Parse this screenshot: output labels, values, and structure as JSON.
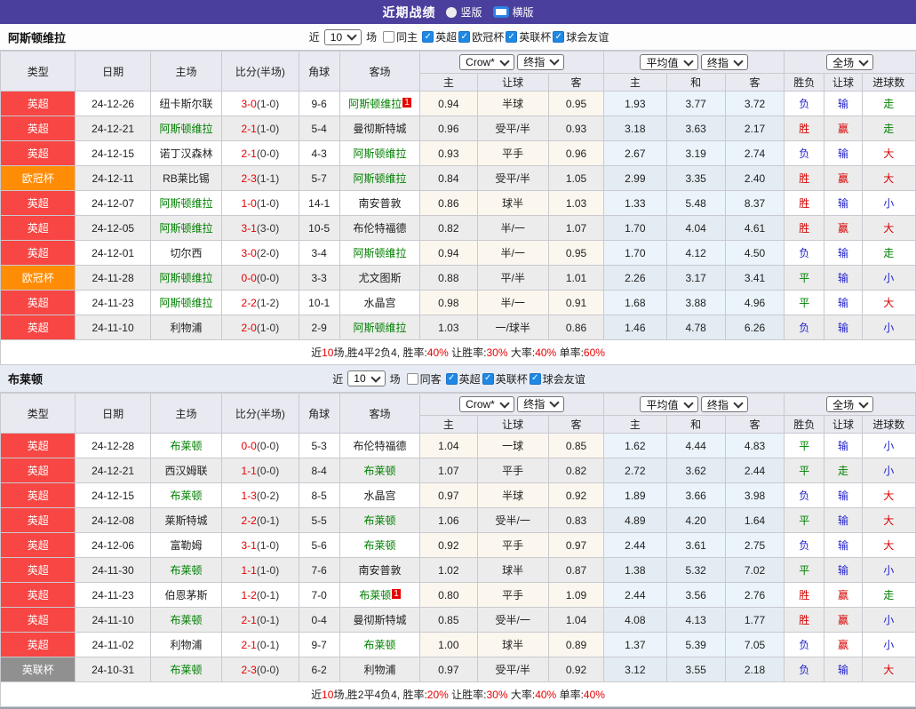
{
  "title_bar": {
    "title": "近期战绩",
    "radios": [
      {
        "label": "竖版",
        "selected": false
      },
      {
        "label": "横版",
        "selected": true
      }
    ]
  },
  "colors": {
    "topbar_purple": "#4b3f9d",
    "league_red": "#f74643",
    "league_orange": "#ff8c05",
    "league_gray": "#909090",
    "focus_team_green": "#008000",
    "score_red": "#e60000",
    "result_red": "#d60000",
    "result_blue": "#2222cc",
    "result_green": "#008000",
    "checkbox_blue": "#1e88e5",
    "avg_col_blue": "#eaf4fa",
    "crow_col_cream": "#fcf7ee"
  },
  "table_header": {
    "cols": [
      "类型",
      "日期",
      "主场",
      "比分(半场)",
      "角球",
      "客场"
    ],
    "sub": [
      "主",
      "让球",
      "客",
      "主",
      "和",
      "客",
      "胜负",
      "让球",
      "进球数"
    ],
    "selects": {
      "crow": "Crow*",
      "final1": "终指",
      "avg": "平均值",
      "final2": "终指",
      "full": "全场"
    }
  },
  "sections": [
    {
      "team": "阿斯顿维拉",
      "filter": {
        "near_label": "近",
        "count": "10",
        "games_label": "场",
        "same_label": "同主",
        "same_checked": false,
        "leagues": [
          {
            "label": "英超",
            "checked": true
          },
          {
            "label": "欧冠杯",
            "checked": true
          },
          {
            "label": "英联杯",
            "checked": true
          },
          {
            "label": "球会友谊",
            "checked": true
          }
        ]
      },
      "rows": [
        {
          "league": "英超",
          "date": "24-12-26",
          "home": "纽卡斯尔联",
          "ft": "3-0",
          "ht": "(1-0)",
          "corner": "9-6",
          "away": "阿斯顿维拉",
          "badge": "1",
          "crow": [
            "0.94",
            "半球",
            "0.95"
          ],
          "avg": [
            "1.93",
            "3.77",
            "3.72"
          ],
          "results": [
            "负",
            "输",
            "走"
          ]
        },
        {
          "league": "英超",
          "date": "24-12-21",
          "home": "阿斯顿维拉",
          "ft": "2-1",
          "ht": "(1-0)",
          "corner": "5-4",
          "away": "曼彻斯特城",
          "crow": [
            "0.96",
            "受平/半",
            "0.93"
          ],
          "avg": [
            "3.18",
            "3.63",
            "2.17"
          ],
          "results": [
            "胜",
            "赢",
            "走"
          ]
        },
        {
          "league": "英超",
          "date": "24-12-15",
          "home": "诺丁汉森林",
          "ft": "2-1",
          "ht": "(0-0)",
          "corner": "4-3",
          "away": "阿斯顿维拉",
          "crow": [
            "0.93",
            "平手",
            "0.96"
          ],
          "avg": [
            "2.67",
            "3.19",
            "2.74"
          ],
          "results": [
            "负",
            "输",
            "大"
          ]
        },
        {
          "league": "欧冠杯",
          "date": "24-12-11",
          "home": "RB莱比锡",
          "ft": "2-3",
          "ht": "(1-1)",
          "corner": "5-7",
          "away": "阿斯顿维拉",
          "crow": [
            "0.84",
            "受平/半",
            "1.05"
          ],
          "avg": [
            "2.99",
            "3.35",
            "2.40"
          ],
          "results": [
            "胜",
            "赢",
            "大"
          ]
        },
        {
          "league": "英超",
          "date": "24-12-07",
          "home": "阿斯顿维拉",
          "ft": "1-0",
          "ht": "(1-0)",
          "corner": "14-1",
          "away": "南安普敦",
          "crow": [
            "0.86",
            "球半",
            "1.03"
          ],
          "avg": [
            "1.33",
            "5.48",
            "8.37"
          ],
          "results": [
            "胜",
            "输",
            "小"
          ]
        },
        {
          "league": "英超",
          "date": "24-12-05",
          "home": "阿斯顿维拉",
          "ft": "3-1",
          "ht": "(3-0)",
          "corner": "10-5",
          "away": "布伦特福德",
          "crow": [
            "0.82",
            "半/一",
            "1.07"
          ],
          "avg": [
            "1.70",
            "4.04",
            "4.61"
          ],
          "results": [
            "胜",
            "赢",
            "大"
          ]
        },
        {
          "league": "英超",
          "date": "24-12-01",
          "home": "切尔西",
          "ft": "3-0",
          "ht": "(2-0)",
          "corner": "3-4",
          "away": "阿斯顿维拉",
          "crow": [
            "0.94",
            "半/一",
            "0.95"
          ],
          "avg": [
            "1.70",
            "4.12",
            "4.50"
          ],
          "results": [
            "负",
            "输",
            "走"
          ]
        },
        {
          "league": "欧冠杯",
          "date": "24-11-28",
          "home": "阿斯顿维拉",
          "ft": "0-0",
          "ht": "(0-0)",
          "corner": "3-3",
          "away": "尤文图斯",
          "crow": [
            "0.88",
            "平/半",
            "1.01"
          ],
          "avg": [
            "2.26",
            "3.17",
            "3.41"
          ],
          "results": [
            "平",
            "输",
            "小"
          ]
        },
        {
          "league": "英超",
          "date": "24-11-23",
          "home": "阿斯顿维拉",
          "ft": "2-2",
          "ht": "(1-2)",
          "corner": "10-1",
          "away": "水晶宫",
          "crow": [
            "0.98",
            "半/一",
            "0.91"
          ],
          "avg": [
            "1.68",
            "3.88",
            "4.96"
          ],
          "results": [
            "平",
            "输",
            "大"
          ]
        },
        {
          "league": "英超",
          "date": "24-11-10",
          "home": "利物浦",
          "ft": "2-0",
          "ht": "(1-0)",
          "corner": "2-9",
          "away": "阿斯顿维拉",
          "crow": [
            "1.03",
            "一/球半",
            "0.86"
          ],
          "avg": [
            "1.46",
            "4.78",
            "6.26"
          ],
          "results": [
            "负",
            "输",
            "小"
          ]
        }
      ],
      "summary": [
        "近",
        "10",
        "场,胜4平2负4, 胜率:",
        "40%",
        " 让胜率:",
        "30%",
        " 大率:",
        "40%",
        " 单率:",
        "60%"
      ]
    },
    {
      "team": "布莱顿",
      "filter": {
        "near_label": "近",
        "count": "10",
        "games_label": "场",
        "same_label": "同客",
        "same_checked": false,
        "leagues": [
          {
            "label": "英超",
            "checked": true
          },
          {
            "label": "英联杯",
            "checked": true
          },
          {
            "label": "球会友谊",
            "checked": true
          }
        ]
      },
      "rows": [
        {
          "league": "英超",
          "date": "24-12-28",
          "home": "布莱顿",
          "ft": "0-0",
          "ht": "(0-0)",
          "corner": "5-3",
          "away": "布伦特福德",
          "crow": [
            "1.04",
            "一球",
            "0.85"
          ],
          "avg": [
            "1.62",
            "4.44",
            "4.83"
          ],
          "results": [
            "平",
            "输",
            "小"
          ]
        },
        {
          "league": "英超",
          "date": "24-12-21",
          "home": "西汉姆联",
          "ft": "1-1",
          "ht": "(0-0)",
          "corner": "8-4",
          "away": "布莱顿",
          "crow": [
            "1.07",
            "平手",
            "0.82"
          ],
          "avg": [
            "2.72",
            "3.62",
            "2.44"
          ],
          "results": [
            "平",
            "走",
            "小"
          ]
        },
        {
          "league": "英超",
          "date": "24-12-15",
          "home": "布莱顿",
          "ft": "1-3",
          "ht": "(0-2)",
          "corner": "8-5",
          "away": "水晶宫",
          "crow": [
            "0.97",
            "半球",
            "0.92"
          ],
          "avg": [
            "1.89",
            "3.66",
            "3.98"
          ],
          "results": [
            "负",
            "输",
            "大"
          ]
        },
        {
          "league": "英超",
          "date": "24-12-08",
          "home": "莱斯特城",
          "ft": "2-2",
          "ht": "(0-1)",
          "corner": "5-5",
          "away": "布莱顿",
          "crow": [
            "1.06",
            "受半/一",
            "0.83"
          ],
          "avg": [
            "4.89",
            "4.20",
            "1.64"
          ],
          "results": [
            "平",
            "输",
            "大"
          ]
        },
        {
          "league": "英超",
          "date": "24-12-06",
          "home": "富勒姆",
          "ft": "3-1",
          "ht": "(1-0)",
          "corner": "5-6",
          "away": "布莱顿",
          "crow": [
            "0.92",
            "平手",
            "0.97"
          ],
          "avg": [
            "2.44",
            "3.61",
            "2.75"
          ],
          "results": [
            "负",
            "输",
            "大"
          ]
        },
        {
          "league": "英超",
          "date": "24-11-30",
          "home": "布莱顿",
          "ft": "1-1",
          "ht": "(1-0)",
          "corner": "7-6",
          "away": "南安普敦",
          "crow": [
            "1.02",
            "球半",
            "0.87"
          ],
          "avg": [
            "1.38",
            "5.32",
            "7.02"
          ],
          "results": [
            "平",
            "输",
            "小"
          ]
        },
        {
          "league": "英超",
          "date": "24-11-23",
          "home": "伯恩茅斯",
          "ft": "1-2",
          "ht": "(0-1)",
          "corner": "7-0",
          "away": "布莱顿",
          "badge": "1",
          "crow": [
            "0.80",
            "平手",
            "1.09"
          ],
          "avg": [
            "2.44",
            "3.56",
            "2.76"
          ],
          "results": [
            "胜",
            "赢",
            "走"
          ]
        },
        {
          "league": "英超",
          "date": "24-11-10",
          "home": "布莱顿",
          "ft": "2-1",
          "ht": "(0-1)",
          "corner": "0-4",
          "away": "曼彻斯特城",
          "crow": [
            "0.85",
            "受半/一",
            "1.04"
          ],
          "avg": [
            "4.08",
            "4.13",
            "1.77"
          ],
          "results": [
            "胜",
            "赢",
            "小"
          ]
        },
        {
          "league": "英超",
          "date": "24-11-02",
          "home": "利物浦",
          "ft": "2-1",
          "ht": "(0-1)",
          "corner": "9-7",
          "away": "布莱顿",
          "crow": [
            "1.00",
            "球半",
            "0.89"
          ],
          "avg": [
            "1.37",
            "5.39",
            "7.05"
          ],
          "results": [
            "负",
            "赢",
            "小"
          ]
        },
        {
          "league": "英联杯",
          "date": "24-10-31",
          "home": "布莱顿",
          "ft": "2-3",
          "ht": "(0-0)",
          "corner": "6-2",
          "away": "利物浦",
          "crow": [
            "0.97",
            "受平/半",
            "0.92"
          ],
          "avg": [
            "3.12",
            "3.55",
            "2.18"
          ],
          "results": [
            "负",
            "输",
            "大"
          ]
        }
      ],
      "summary": [
        "近",
        "10",
        "场,胜2平4负4, 胜率:",
        "20%",
        " 让胜率:",
        "30%",
        " 大率:",
        "40%",
        " 单率:",
        "40%"
      ]
    }
  ]
}
